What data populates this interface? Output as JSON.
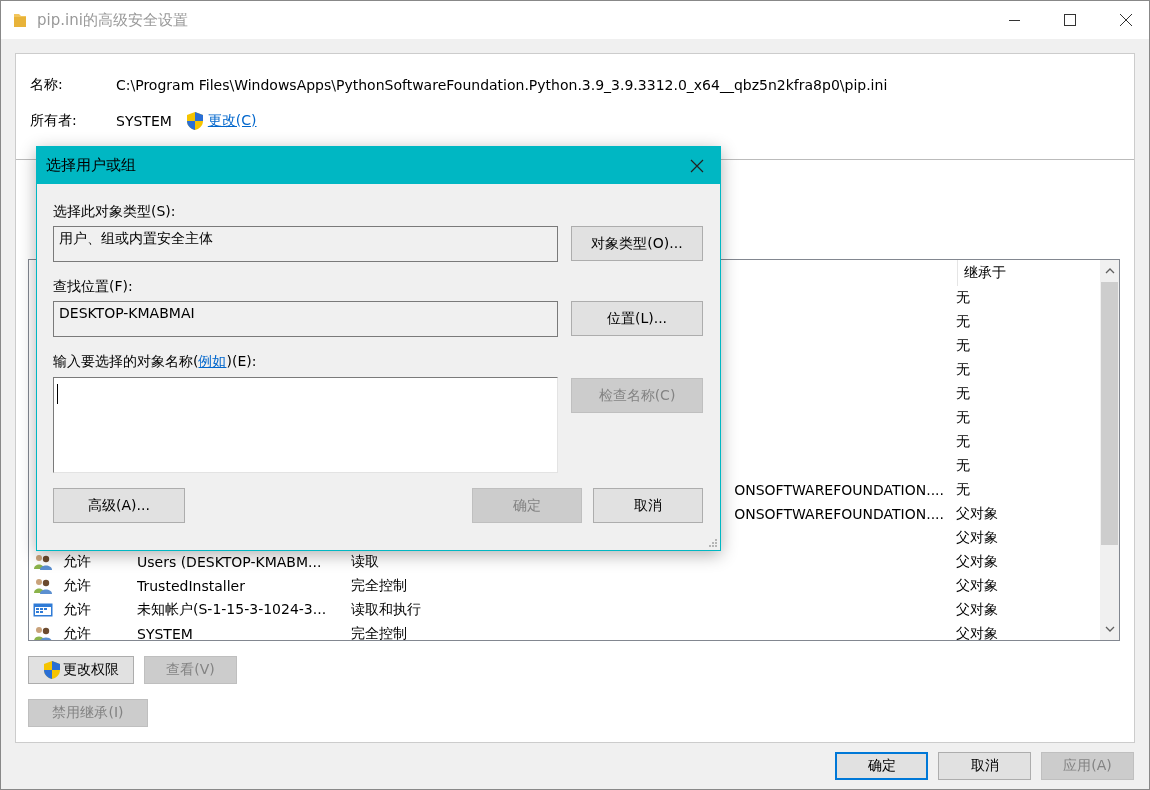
{
  "window": {
    "title": "pip.ini的高级安全设置"
  },
  "name_label": "名称:",
  "name_value": "C:\\Program Files\\WindowsApps\\PythonSoftwareFoundation.Python.3.9_3.9.3312.0_x64__qbz5n2kfra8p0\\pip.ini",
  "owner_label": "所有者:",
  "owner_value": "SYSTEM",
  "owner_change_link": "更改(C)",
  "table": {
    "columns": [
      "继承于"
    ],
    "rows": [
      {
        "inherited": "无"
      },
      {
        "inherited": "无"
      },
      {
        "inherited": "无"
      },
      {
        "inherited": "无"
      },
      {
        "inherited": "无"
      },
      {
        "inherited": "无"
      },
      {
        "inherited": "无"
      },
      {
        "inherited": "无"
      },
      {
        "column_3": "ONSOFTWAREFOUNDATION....",
        "inherited": "无"
      },
      {
        "column_3": "ONSOFTWAREFOUNDATION....",
        "inherited": "父对象"
      },
      {
        "inherited": "父对象"
      },
      {
        "kind": "group",
        "type": "允许",
        "principal": "Users (DESKTOP-KMABM...",
        "access": "读取",
        "inherited": "父对象"
      },
      {
        "kind": "group",
        "type": "允许",
        "principal": "TrustedInstaller",
        "access": "完全控制",
        "inherited": "父对象"
      },
      {
        "kind": "app",
        "type": "允许",
        "principal": "未知帐户(S-1-15-3-1024-3...",
        "access": "读取和执行",
        "inherited": "父对象"
      },
      {
        "kind": "group",
        "type": "允许",
        "principal": "SYSTEM",
        "access": "完全控制",
        "inherited": "父对象"
      }
    ]
  },
  "table_buttons": [
    {
      "label": "更改权限",
      "disabled": false,
      "shield": true
    },
    {
      "label": "查看(V)",
      "disabled": true,
      "shield": false
    }
  ],
  "inheritance_button": {
    "label": "禁用继承(I)",
    "disabled": true
  },
  "buttons": [
    {
      "label": "确定",
      "disabled": false,
      "focused": true
    },
    {
      "label": "取消",
      "disabled": false,
      "focused": false
    },
    {
      "label": "应用(A)",
      "disabled": true,
      "focused": false
    }
  ],
  "dialog": {
    "title": "选择用户或组",
    "object_type_label": "选择此对象类型(S):",
    "object_type_value": "用户、组或内置安全主体",
    "object_type_button": "对象类型(O)...",
    "location_label": "查找位置(F):",
    "location_value": "DESKTOP-KMABMAI",
    "location_button": "位置(L)...",
    "names_label_before": "输入要选择的对象名称(",
    "names_label_link": "例如",
    "names_label_after": ")(E):",
    "check_button": {
      "label": "检查名称(C)",
      "disabled": true
    },
    "advanced_button": {
      "label": "高级(A)...",
      "disabled": false
    },
    "ok_button": {
      "label": "确定",
      "disabled": true
    },
    "cancel_button": {
      "label": "取消",
      "disabled": false
    }
  }
}
